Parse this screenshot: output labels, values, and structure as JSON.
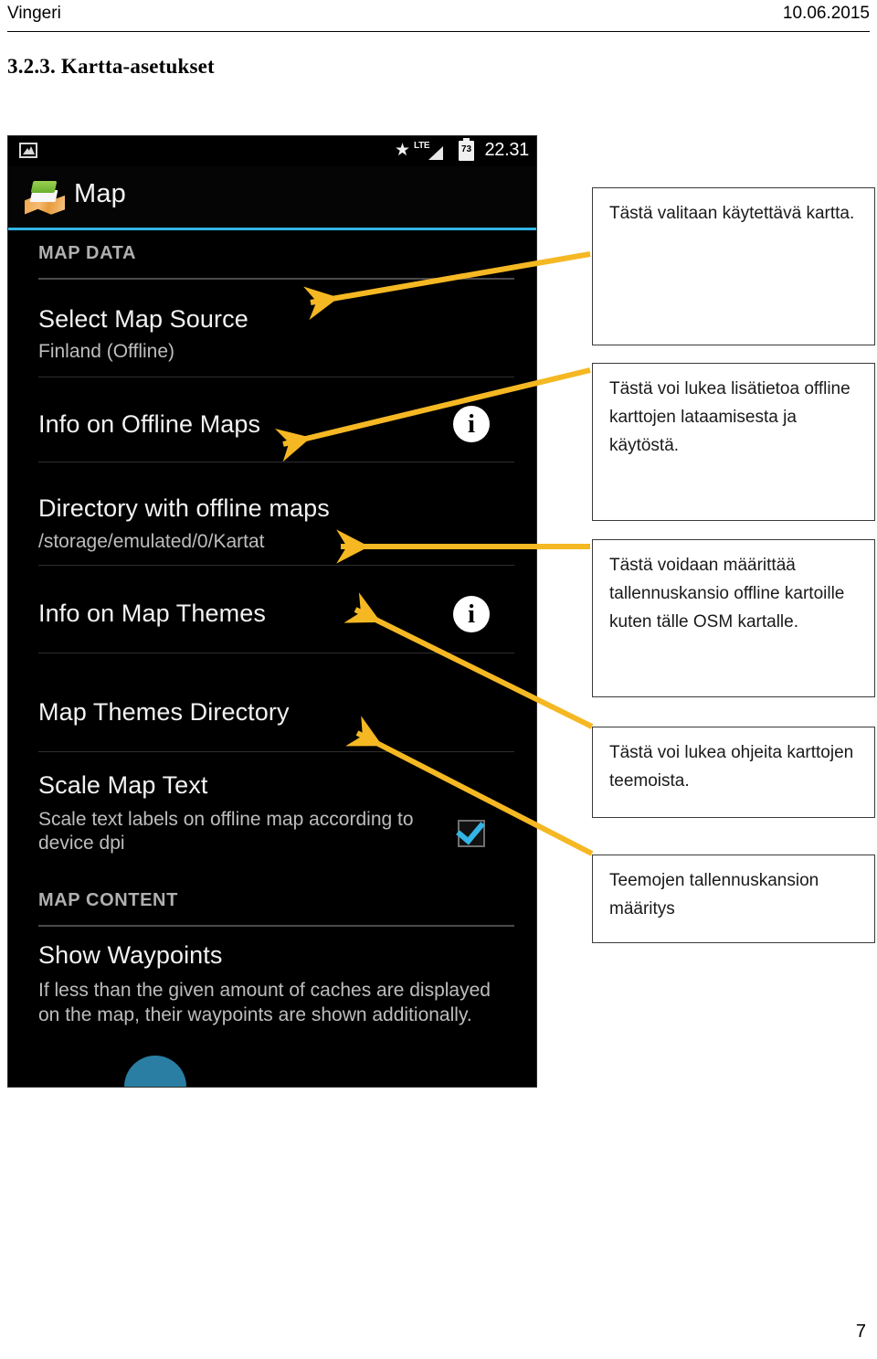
{
  "document": {
    "header_left": "Vingeri",
    "header_right": "10.06.2015",
    "section_heading": "3.2.3. Kartta-asetukset",
    "page_number": "7"
  },
  "phone": {
    "status_bar": {
      "image_icon": "image-icon",
      "star_icon": "★",
      "network_label": "LTE",
      "battery_level": "73",
      "time": "22.31"
    },
    "action_bar": {
      "icon": "map-layers-icon",
      "title": "Map"
    },
    "categories": [
      {
        "label": "MAP DATA"
      },
      {
        "label": "MAP CONTENT"
      }
    ],
    "preferences": [
      {
        "title": "Select Map Source",
        "summary": "Finland (Offline)",
        "widget": "none"
      },
      {
        "title": "Info on Offline Maps",
        "summary": "",
        "widget": "info-icon",
        "widget_glyph": "i"
      },
      {
        "title": "Directory with offline maps",
        "summary": "/storage/emulated/0/Kartat",
        "widget": "none"
      },
      {
        "title": "Info on Map Themes",
        "summary": "",
        "widget": "info-icon",
        "widget_glyph": "i"
      },
      {
        "title": "Map Themes Directory",
        "summary": "",
        "widget": "none"
      },
      {
        "title": "Scale Map Text",
        "summary": "Scale text labels on offline map according to device dpi",
        "widget": "checkbox",
        "checked": true
      },
      {
        "title": "Show Waypoints",
        "summary": "If less than the given amount of caches are displayed on the map, their waypoints are shown additionally.",
        "widget": "none"
      }
    ]
  },
  "callouts": [
    {
      "text": "Tästä valitaan käytettävä kartta."
    },
    {
      "text": "Tästä voi lukea lisätietoa offline karttojen lataamisesta ja käytöstä."
    },
    {
      "text": "Tästä voidaan määrittää tallennuskansio offline kartoille kuten tälle OSM kartalle."
    },
    {
      "text": "Tästä voi lukea ohjeita karttojen teemoista."
    },
    {
      "text": "Teemojen tallennuskansion määritys"
    }
  ],
  "colors": {
    "arrow": "#f5b823",
    "accent": "#33b5e5",
    "checkbox_tick": "#33b5e5"
  }
}
